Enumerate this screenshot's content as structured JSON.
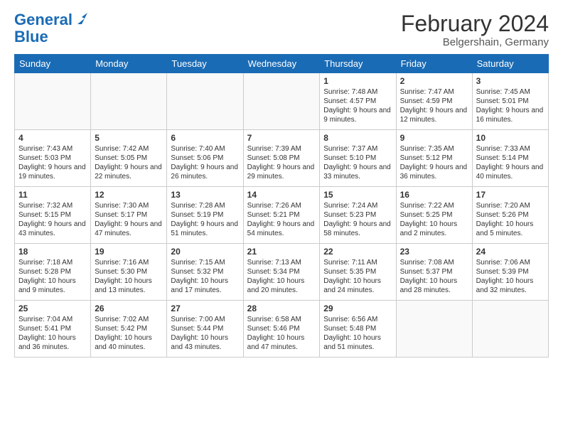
{
  "header": {
    "logo_line1": "General",
    "logo_line2": "Blue",
    "title": "February 2024",
    "subtitle": "Belgershain, Germany"
  },
  "days_of_week": [
    "Sunday",
    "Monday",
    "Tuesday",
    "Wednesday",
    "Thursday",
    "Friday",
    "Saturday"
  ],
  "weeks": [
    [
      {
        "day": "",
        "sunrise": "",
        "sunset": "",
        "daylight": ""
      },
      {
        "day": "",
        "sunrise": "",
        "sunset": "",
        "daylight": ""
      },
      {
        "day": "",
        "sunrise": "",
        "sunset": "",
        "daylight": ""
      },
      {
        "day": "",
        "sunrise": "",
        "sunset": "",
        "daylight": ""
      },
      {
        "day": "1",
        "sunrise": "Sunrise: 7:48 AM",
        "sunset": "Sunset: 4:57 PM",
        "daylight": "Daylight: 9 hours and 9 minutes."
      },
      {
        "day": "2",
        "sunrise": "Sunrise: 7:47 AM",
        "sunset": "Sunset: 4:59 PM",
        "daylight": "Daylight: 9 hours and 12 minutes."
      },
      {
        "day": "3",
        "sunrise": "Sunrise: 7:45 AM",
        "sunset": "Sunset: 5:01 PM",
        "daylight": "Daylight: 9 hours and 16 minutes."
      }
    ],
    [
      {
        "day": "4",
        "sunrise": "Sunrise: 7:43 AM",
        "sunset": "Sunset: 5:03 PM",
        "daylight": "Daylight: 9 hours and 19 minutes."
      },
      {
        "day": "5",
        "sunrise": "Sunrise: 7:42 AM",
        "sunset": "Sunset: 5:05 PM",
        "daylight": "Daylight: 9 hours and 22 minutes."
      },
      {
        "day": "6",
        "sunrise": "Sunrise: 7:40 AM",
        "sunset": "Sunset: 5:06 PM",
        "daylight": "Daylight: 9 hours and 26 minutes."
      },
      {
        "day": "7",
        "sunrise": "Sunrise: 7:39 AM",
        "sunset": "Sunset: 5:08 PM",
        "daylight": "Daylight: 9 hours and 29 minutes."
      },
      {
        "day": "8",
        "sunrise": "Sunrise: 7:37 AM",
        "sunset": "Sunset: 5:10 PM",
        "daylight": "Daylight: 9 hours and 33 minutes."
      },
      {
        "day": "9",
        "sunrise": "Sunrise: 7:35 AM",
        "sunset": "Sunset: 5:12 PM",
        "daylight": "Daylight: 9 hours and 36 minutes."
      },
      {
        "day": "10",
        "sunrise": "Sunrise: 7:33 AM",
        "sunset": "Sunset: 5:14 PM",
        "daylight": "Daylight: 9 hours and 40 minutes."
      }
    ],
    [
      {
        "day": "11",
        "sunrise": "Sunrise: 7:32 AM",
        "sunset": "Sunset: 5:15 PM",
        "daylight": "Daylight: 9 hours and 43 minutes."
      },
      {
        "day": "12",
        "sunrise": "Sunrise: 7:30 AM",
        "sunset": "Sunset: 5:17 PM",
        "daylight": "Daylight: 9 hours and 47 minutes."
      },
      {
        "day": "13",
        "sunrise": "Sunrise: 7:28 AM",
        "sunset": "Sunset: 5:19 PM",
        "daylight": "Daylight: 9 hours and 51 minutes."
      },
      {
        "day": "14",
        "sunrise": "Sunrise: 7:26 AM",
        "sunset": "Sunset: 5:21 PM",
        "daylight": "Daylight: 9 hours and 54 minutes."
      },
      {
        "day": "15",
        "sunrise": "Sunrise: 7:24 AM",
        "sunset": "Sunset: 5:23 PM",
        "daylight": "Daylight: 9 hours and 58 minutes."
      },
      {
        "day": "16",
        "sunrise": "Sunrise: 7:22 AM",
        "sunset": "Sunset: 5:25 PM",
        "daylight": "Daylight: 10 hours and 2 minutes."
      },
      {
        "day": "17",
        "sunrise": "Sunrise: 7:20 AM",
        "sunset": "Sunset: 5:26 PM",
        "daylight": "Daylight: 10 hours and 5 minutes."
      }
    ],
    [
      {
        "day": "18",
        "sunrise": "Sunrise: 7:18 AM",
        "sunset": "Sunset: 5:28 PM",
        "daylight": "Daylight: 10 hours and 9 minutes."
      },
      {
        "day": "19",
        "sunrise": "Sunrise: 7:16 AM",
        "sunset": "Sunset: 5:30 PM",
        "daylight": "Daylight: 10 hours and 13 minutes."
      },
      {
        "day": "20",
        "sunrise": "Sunrise: 7:15 AM",
        "sunset": "Sunset: 5:32 PM",
        "daylight": "Daylight: 10 hours and 17 minutes."
      },
      {
        "day": "21",
        "sunrise": "Sunrise: 7:13 AM",
        "sunset": "Sunset: 5:34 PM",
        "daylight": "Daylight: 10 hours and 20 minutes."
      },
      {
        "day": "22",
        "sunrise": "Sunrise: 7:11 AM",
        "sunset": "Sunset: 5:35 PM",
        "daylight": "Daylight: 10 hours and 24 minutes."
      },
      {
        "day": "23",
        "sunrise": "Sunrise: 7:08 AM",
        "sunset": "Sunset: 5:37 PM",
        "daylight": "Daylight: 10 hours and 28 minutes."
      },
      {
        "day": "24",
        "sunrise": "Sunrise: 7:06 AM",
        "sunset": "Sunset: 5:39 PM",
        "daylight": "Daylight: 10 hours and 32 minutes."
      }
    ],
    [
      {
        "day": "25",
        "sunrise": "Sunrise: 7:04 AM",
        "sunset": "Sunset: 5:41 PM",
        "daylight": "Daylight: 10 hours and 36 minutes."
      },
      {
        "day": "26",
        "sunrise": "Sunrise: 7:02 AM",
        "sunset": "Sunset: 5:42 PM",
        "daylight": "Daylight: 10 hours and 40 minutes."
      },
      {
        "day": "27",
        "sunrise": "Sunrise: 7:00 AM",
        "sunset": "Sunset: 5:44 PM",
        "daylight": "Daylight: 10 hours and 43 minutes."
      },
      {
        "day": "28",
        "sunrise": "Sunrise: 6:58 AM",
        "sunset": "Sunset: 5:46 PM",
        "daylight": "Daylight: 10 hours and 47 minutes."
      },
      {
        "day": "29",
        "sunrise": "Sunrise: 6:56 AM",
        "sunset": "Sunset: 5:48 PM",
        "daylight": "Daylight: 10 hours and 51 minutes."
      },
      {
        "day": "",
        "sunrise": "",
        "sunset": "",
        "daylight": ""
      },
      {
        "day": "",
        "sunrise": "",
        "sunset": "",
        "daylight": ""
      }
    ]
  ]
}
